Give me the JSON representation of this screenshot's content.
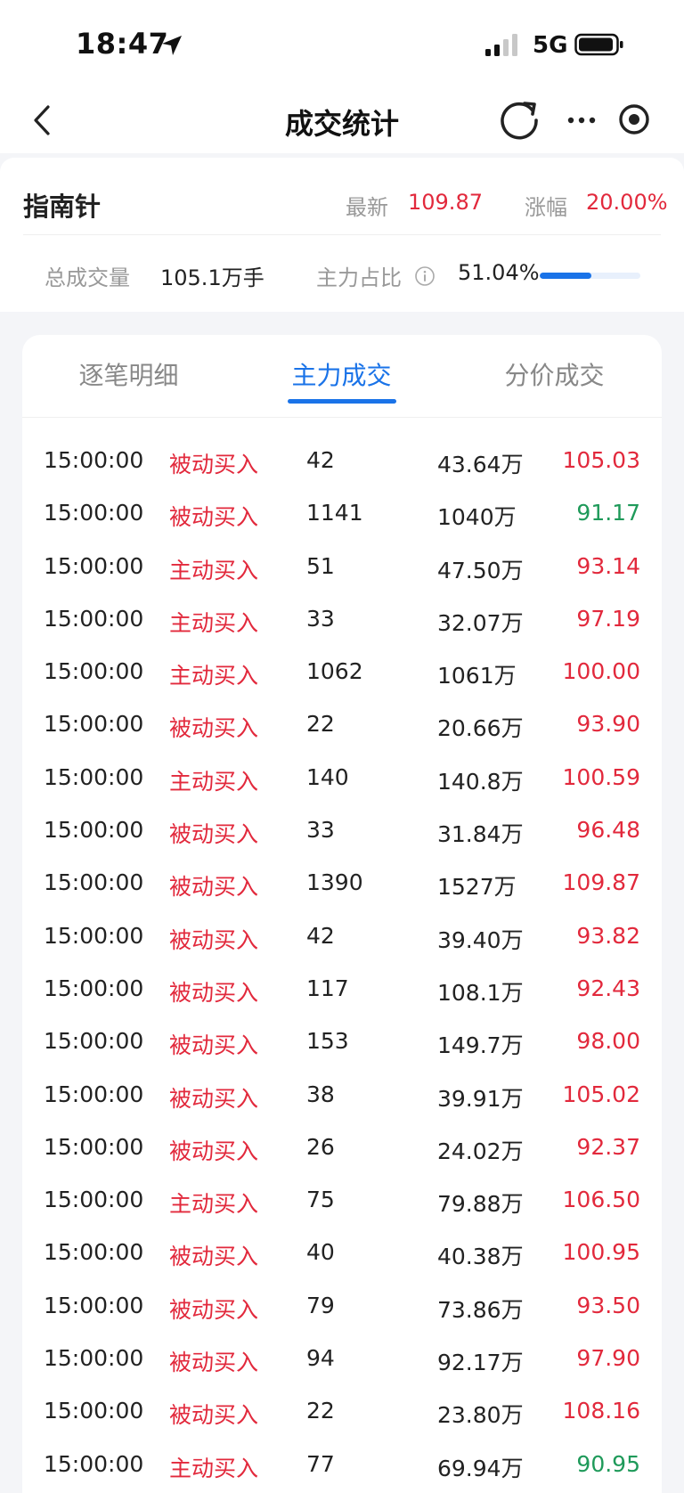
{
  "status_bar": {
    "time": "18:47",
    "network": "5G"
  },
  "nav": {
    "title": "成交统计"
  },
  "stock": {
    "name": "指南针",
    "latest_label": "最新",
    "latest_value": "109.87",
    "change_label": "涨幅",
    "change_value": "20.00%",
    "volume_label": "总成交量",
    "volume_value": "105.1万手",
    "ratio_label": "主力占比",
    "ratio_value": "51.04%",
    "ratio_fraction": 0.5104
  },
  "tabs": [
    {
      "label": "逐笔明细",
      "active": false
    },
    {
      "label": "主力成交",
      "active": true
    },
    {
      "label": "分价成交",
      "active": false
    }
  ],
  "colors": {
    "up": "#e2293c",
    "down": "#1f9a5a",
    "accent": "#1a73e8"
  },
  "trades": [
    {
      "time": "15:00:00",
      "type": "被动买入",
      "volume": "42",
      "amount": "43.64万",
      "price": "105.03",
      "direction": "up"
    },
    {
      "time": "15:00:00",
      "type": "被动买入",
      "volume": "1141",
      "amount": "1040万",
      "price": "91.17",
      "direction": "down"
    },
    {
      "time": "15:00:00",
      "type": "主动买入",
      "volume": "51",
      "amount": "47.50万",
      "price": "93.14",
      "direction": "up"
    },
    {
      "time": "15:00:00",
      "type": "主动买入",
      "volume": "33",
      "amount": "32.07万",
      "price": "97.19",
      "direction": "up"
    },
    {
      "time": "15:00:00",
      "type": "主动买入",
      "volume": "1062",
      "amount": "1061万",
      "price": "100.00",
      "direction": "up"
    },
    {
      "time": "15:00:00",
      "type": "被动买入",
      "volume": "22",
      "amount": "20.66万",
      "price": "93.90",
      "direction": "up"
    },
    {
      "time": "15:00:00",
      "type": "主动买入",
      "volume": "140",
      "amount": "140.8万",
      "price": "100.59",
      "direction": "up"
    },
    {
      "time": "15:00:00",
      "type": "被动买入",
      "volume": "33",
      "amount": "31.84万",
      "price": "96.48",
      "direction": "up"
    },
    {
      "time": "15:00:00",
      "type": "被动买入",
      "volume": "1390",
      "amount": "1527万",
      "price": "109.87",
      "direction": "up"
    },
    {
      "time": "15:00:00",
      "type": "被动买入",
      "volume": "42",
      "amount": "39.40万",
      "price": "93.82",
      "direction": "up"
    },
    {
      "time": "15:00:00",
      "type": "被动买入",
      "volume": "117",
      "amount": "108.1万",
      "price": "92.43",
      "direction": "up"
    },
    {
      "time": "15:00:00",
      "type": "被动买入",
      "volume": "153",
      "amount": "149.7万",
      "price": "98.00",
      "direction": "up"
    },
    {
      "time": "15:00:00",
      "type": "被动买入",
      "volume": "38",
      "amount": "39.91万",
      "price": "105.02",
      "direction": "up"
    },
    {
      "time": "15:00:00",
      "type": "被动买入",
      "volume": "26",
      "amount": "24.02万",
      "price": "92.37",
      "direction": "up"
    },
    {
      "time": "15:00:00",
      "type": "主动买入",
      "volume": "75",
      "amount": "79.88万",
      "price": "106.50",
      "direction": "up"
    },
    {
      "time": "15:00:00",
      "type": "被动买入",
      "volume": "40",
      "amount": "40.38万",
      "price": "100.95",
      "direction": "up"
    },
    {
      "time": "15:00:00",
      "type": "被动买入",
      "volume": "79",
      "amount": "73.86万",
      "price": "93.50",
      "direction": "up"
    },
    {
      "time": "15:00:00",
      "type": "被动买入",
      "volume": "94",
      "amount": "92.17万",
      "price": "97.90",
      "direction": "up"
    },
    {
      "time": "15:00:00",
      "type": "被动买入",
      "volume": "22",
      "amount": "23.80万",
      "price": "108.16",
      "direction": "up"
    },
    {
      "time": "15:00:00",
      "type": "主动买入",
      "volume": "77",
      "amount": "69.94万",
      "price": "90.95",
      "direction": "down"
    }
  ]
}
